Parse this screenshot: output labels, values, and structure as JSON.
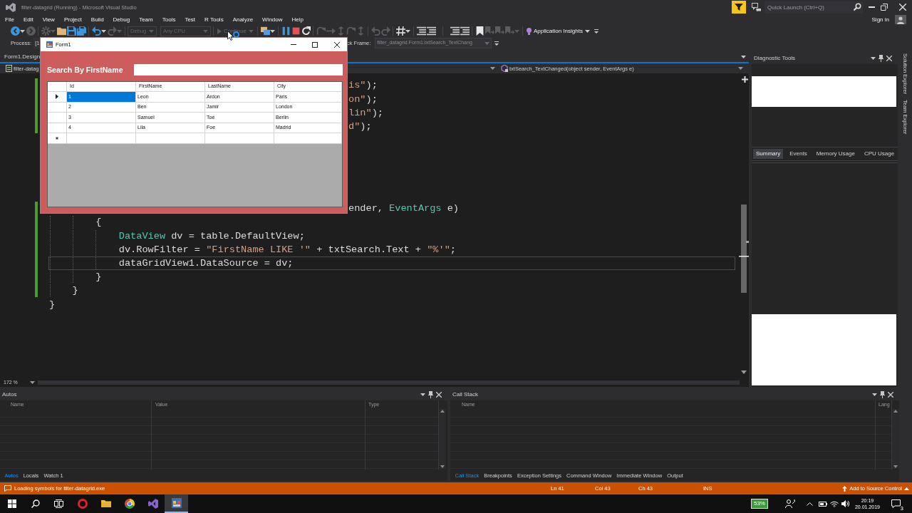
{
  "window": {
    "title": "filter-datagrid (Running) - Microsoft Visual Studio"
  },
  "quick_launch": {
    "placeholder": "Quick Launch (Ctrl+Q)"
  },
  "menu": [
    "File",
    "Edit",
    "View",
    "Project",
    "Build",
    "Debug",
    "Team",
    "Tools",
    "Test",
    "R Tools",
    "Analyze",
    "Window",
    "Help"
  ],
  "account": {
    "label": "Sign in"
  },
  "toolbar": [
    {
      "kind": "icon",
      "disabled": false
    },
    {
      "kind": "icon",
      "disabled": true
    },
    {
      "kind": "icon",
      "disabled": true
    },
    {
      "kind": "icon",
      "disabled": false
    },
    {
      "kind": "icon",
      "disabled": false
    },
    {
      "kind": "icon",
      "disabled": false
    },
    {
      "kind": "icon",
      "disabled": false
    },
    {
      "kind": "icon",
      "disabled": true
    },
    {
      "kind": "dropdown",
      "value": "Debug",
      "disabled": true
    },
    {
      "kind": "dropdown",
      "value": "Any CPU",
      "disabled": true
    },
    {
      "kind": "button",
      "label": "Continue",
      "disabled": true
    },
    {
      "kind": "icon",
      "disabled": false
    },
    {
      "kind": "icon",
      "disabled": false
    },
    {
      "kind": "icon",
      "disabled": false
    },
    {
      "kind": "icon",
      "disabled": false
    },
    {
      "kind": "icon",
      "disabled": true
    },
    {
      "kind": "icon",
      "disabled": true
    },
    {
      "kind": "icon",
      "disabled": true
    },
    {
      "kind": "icon",
      "disabled": true
    },
    {
      "kind": "icon",
      "disabled": true
    },
    {
      "kind": "icon",
      "disabled": true
    },
    {
      "kind": "icon",
      "disabled": true
    },
    {
      "kind": "icon",
      "disabled": false
    },
    {
      "kind": "icon",
      "disabled": false
    },
    {
      "kind": "icon",
      "disabled": false
    },
    {
      "kind": "icon",
      "disabled": false
    },
    {
      "kind": "icon",
      "disabled": false
    },
    {
      "kind": "icon",
      "disabled": false
    },
    {
      "kind": "icon",
      "disabled": true
    },
    {
      "kind": "icon",
      "disabled": true
    },
    {
      "kind": "icon",
      "disabled": true
    },
    {
      "kind": "button",
      "label": "Application Insights",
      "disabled": false
    }
  ],
  "debug_location": {
    "process_label": "Process:",
    "process": "[1",
    "stack_frame_label": "ck Frame:",
    "stack_frame": "filter_datagrid.Form1.txtSearch_TextChang"
  },
  "document_tabs": [
    {
      "label": "Form1.Design",
      "selected": false
    }
  ],
  "navigation_bar": {
    "project": "filter-datag",
    "member": "txtSearch_TextChanged(object sender, EventArgs e)"
  },
  "editor": {
    "upper_fragments": [
      {
        "tokens": [
          {
            "text": "is\"",
            "kind": "string"
          },
          {
            "text": ");",
            "kind": "plain"
          }
        ],
        "changed": true,
        "current": false
      },
      {
        "tokens": [
          {
            "text": "on\"",
            "kind": "string"
          },
          {
            "text": ");",
            "kind": "plain"
          }
        ],
        "changed": true,
        "current": false
      },
      {
        "tokens": [
          {
            "text": "lin\"",
            "kind": "string"
          },
          {
            "text": ");",
            "kind": "plain"
          }
        ],
        "changed": true,
        "current": false
      },
      {
        "tokens": [
          {
            "text": "d\"",
            "kind": "string"
          },
          {
            "text": ");",
            "kind": "plain"
          }
        ],
        "changed": true,
        "current": false
      }
    ],
    "signature_fragment": {
      "tokens": [
        {
          "text": "ender, ",
          "kind": "plain"
        },
        {
          "text": "EventArgs",
          "kind": "type"
        },
        {
          "text": " e)",
          "kind": "plain"
        }
      ],
      "changed": true,
      "current": false
    },
    "lines": [
      {
        "block": [
          {
            "block": [
              {
                "tokens": [
                  {
                    "text": "{",
                    "kind": "plain"
                  }
                ],
                "changed": true,
                "current": false
              },
              {
                "block": [
                  {
                    "tokens": [
                      {
                        "text": "DataView",
                        "kind": "type"
                      },
                      {
                        "text": " dv = table.DefaultView;",
                        "kind": "plain"
                      }
                    ],
                    "changed": true,
                    "current": false
                  },
                  {
                    "tokens": [
                      {
                        "text": "dv.RowFilter = ",
                        "kind": "plain"
                      },
                      {
                        "text": "\"FirstName LIKE '\"",
                        "kind": "string"
                      },
                      {
                        "text": " + txtSearch.Text + ",
                        "kind": "plain"
                      },
                      {
                        "text": "\"%'\"",
                        "kind": "string"
                      },
                      {
                        "text": ";",
                        "kind": "plain"
                      }
                    ],
                    "changed": true,
                    "current": false
                  },
                  {
                    "tokens": [
                      {
                        "text": "dataGridView1.DataSource = dv;",
                        "kind": "plain"
                      }
                    ],
                    "changed": true,
                    "current": true
                  }
                ]
              },
              {
                "tokens": [
                  {
                    "text": "}",
                    "kind": "plain"
                  }
                ],
                "changed": true,
                "current": false
              }
            ]
          },
          {
            "tokens": [
              {
                "text": "}",
                "kind": "plain"
              }
            ],
            "changed": true,
            "current": false
          }
        ]
      },
      {
        "tokens": [
          {
            "text": "}",
            "kind": "plain"
          }
        ],
        "changed": false,
        "current": false
      }
    ],
    "zoom": "172 %"
  },
  "diagnostic_tools": {
    "title": "Diagnostic Tools",
    "tabs": [
      {
        "label": "Summary",
        "selected": true
      },
      {
        "label": "Events",
        "selected": false
      },
      {
        "label": "Memory Usage",
        "selected": false
      },
      {
        "label": "CPU Usage",
        "selected": false
      }
    ]
  },
  "side_tabs": [
    "Solution Explorer",
    "Team Explorer"
  ],
  "autos_panel": {
    "title": "Autos",
    "columns": [
      "Name",
      "Value",
      "Type"
    ],
    "tabs": [
      {
        "label": "Autos",
        "selected": true
      },
      {
        "label": "Locals",
        "selected": false
      },
      {
        "label": "Watch 1",
        "selected": false
      }
    ]
  },
  "call_stack_panel": {
    "title": "Call Stack",
    "columns": [
      "Name",
      "Lang"
    ],
    "tabs": [
      {
        "label": "Call Stack",
        "selected": true
      },
      {
        "label": "Breakpoints",
        "selected": false
      },
      {
        "label": "Exception Settings",
        "selected": false
      },
      {
        "label": "Command Window",
        "selected": false
      },
      {
        "label": "Immediate Window",
        "selected": false
      },
      {
        "label": "Output",
        "selected": false
      }
    ]
  },
  "status_bar": {
    "message": "Loading symbols for filter-datagrid.exe",
    "line": "Ln 41",
    "column": "Col 43",
    "character": "Ch 43",
    "mode": "INS",
    "source_control": "Add to Source Control"
  },
  "taskbar": {
    "apps": [
      {
        "active": false
      },
      {
        "active": false
      },
      {
        "active": false
      },
      {
        "active": false
      },
      {
        "active": true
      }
    ],
    "battery_meter": "53%",
    "time": "20:19",
    "date": "20.01.2019",
    "notifications": "3"
  },
  "form_window": {
    "title": "Form1",
    "search_label": "Search By FirstName",
    "grid": {
      "columns": [
        "Id",
        "FirstName",
        "LastName",
        "City"
      ],
      "rows": [
        {
          "kind": "data",
          "current": true,
          "cells": [
            {
              "text": "1",
              "selected": true
            },
            {
              "text": "Leon",
              "selected": false
            },
            {
              "text": "Ardon",
              "selected": false
            },
            {
              "text": "Paris",
              "selected": false
            }
          ]
        },
        {
          "kind": "data",
          "current": false,
          "cells": [
            {
              "text": "2",
              "selected": false
            },
            {
              "text": "Ben",
              "selected": false
            },
            {
              "text": "Jamir",
              "selected": false
            },
            {
              "text": "London",
              "selected": false
            }
          ]
        },
        {
          "kind": "data",
          "current": false,
          "cells": [
            {
              "text": "3",
              "selected": false
            },
            {
              "text": "Samuel",
              "selected": false
            },
            {
              "text": "Toe",
              "selected": false
            },
            {
              "text": "Berlin",
              "selected": false
            }
          ]
        },
        {
          "kind": "data",
          "current": false,
          "cells": [
            {
              "text": "4",
              "selected": false
            },
            {
              "text": "Lila",
              "selected": false
            },
            {
              "text": "Foe",
              "selected": false
            },
            {
              "text": "Madrid",
              "selected": false
            }
          ]
        },
        {
          "kind": "new",
          "current": false
        }
      ]
    }
  }
}
